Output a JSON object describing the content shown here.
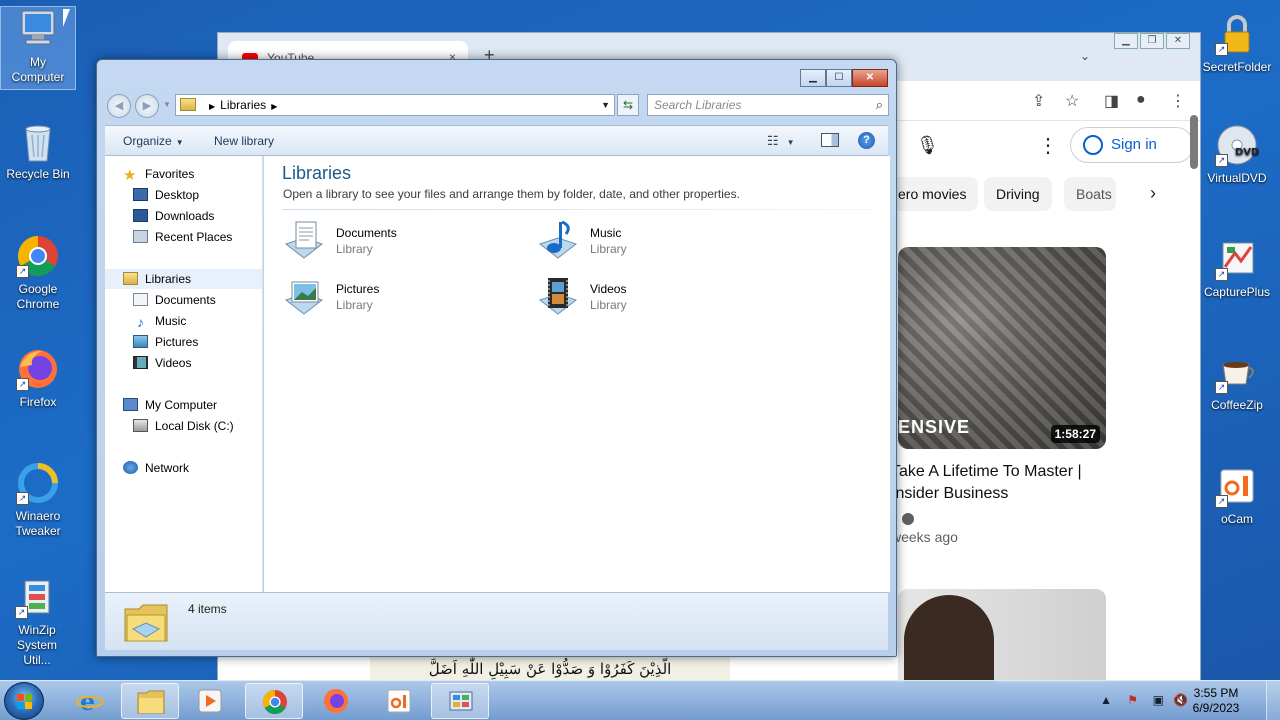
{
  "desktop": {
    "icons_left": [
      {
        "label": "My Computer"
      },
      {
        "label": "Recycle Bin"
      },
      {
        "label": "Google Chrome"
      },
      {
        "label": "Firefox"
      },
      {
        "label": "Winaero Tweaker"
      },
      {
        "label": "WinZip System Util..."
      }
    ],
    "icons_right": [
      {
        "label": "SecretFolder"
      },
      {
        "label": "VirtualDVD"
      },
      {
        "label": "CapturePlus"
      },
      {
        "label": "CoffeeZip"
      },
      {
        "label": "oCam"
      }
    ]
  },
  "browser": {
    "tab_title": "YouTube",
    "tab_close": "×",
    "new_tab": "+",
    "sign_in": "Sign in",
    "chips": [
      "ero movies",
      "Driving",
      "Boats"
    ],
    "video": {
      "thumb_text": "ENSIVE",
      "duration": "1:58:27",
      "title": "Take A Lifetime To Master | Insider Business",
      "meta": "weeks ago"
    }
  },
  "background_strip": {
    "text": "الَّذِيْنَ كَفَرُوْا وَ صَدُّوْا عَنْ سَبِيْلِ اللّٰهِ اَضَلَّ"
  },
  "explorer": {
    "breadcrumb": "Libraries",
    "search_placeholder": "Search Libraries",
    "toolbar": {
      "organize": "Organize",
      "new_library": "New library"
    },
    "nav": {
      "favorites": "Favorites",
      "desktop": "Desktop",
      "downloads": "Downloads",
      "recent_places": "Recent Places",
      "libraries": "Libraries",
      "documents": "Documents",
      "music": "Music",
      "pictures": "Pictures",
      "videos": "Videos",
      "my_computer": "My Computer",
      "local_disk": "Local Disk (C:)",
      "network": "Network"
    },
    "content": {
      "title": "Libraries",
      "description": "Open a library to see your files and arrange them by folder, date, and other properties.",
      "items": [
        {
          "name": "Documents",
          "type": "Library",
          "icon": "documents-library-icon"
        },
        {
          "name": "Music",
          "type": "Library",
          "icon": "music-library-icon"
        },
        {
          "name": "Pictures",
          "type": "Library",
          "icon": "pictures-library-icon"
        },
        {
          "name": "Videos",
          "type": "Library",
          "icon": "videos-library-icon"
        }
      ]
    },
    "status": "4 items"
  },
  "taskbar": {
    "time": "3:55 PM",
    "date": "6/9/2023"
  },
  "colors": {
    "desktop_bg": "#1c6cc7",
    "explorer_frame": "#b7cfeb",
    "library_title": "#1e5a8a",
    "close_button": "#c8442a"
  }
}
